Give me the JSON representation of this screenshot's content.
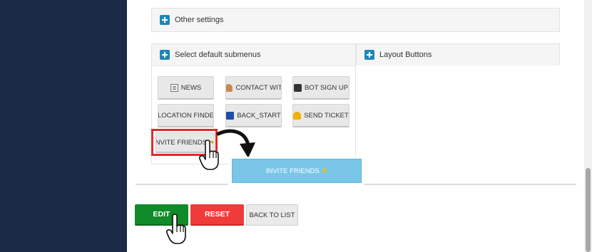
{
  "panels": {
    "other_settings": "Other settings",
    "select_default_submenus": "Select default submenus",
    "layout_buttons": "Layout Buttons"
  },
  "submenu_buttons": [
    {
      "label": "NEWS",
      "icon": "news-icon"
    },
    {
      "label": "CONTACT WIT",
      "icon": "contact-icon"
    },
    {
      "label": "BOT SIGN UP",
      "icon": "bot-icon"
    },
    {
      "label": "LOCATION FINDE",
      "icon": ""
    },
    {
      "label": "BACK_START",
      "icon": "back-icon"
    },
    {
      "label": "SEND TICKET",
      "icon": "bell-icon"
    }
  ],
  "invite_button": {
    "label": "INVITE FRIENDS",
    "icon": "gift-icon"
  },
  "dragging_button": {
    "label": "INVITE FRIENDS",
    "icon": "gift-icon"
  },
  "actions": {
    "edit": "EDIT",
    "reset": "RESET",
    "back": "BACK TO LIST"
  },
  "colors": {
    "sidebar": "#1c2b45",
    "accent_plus": "#1e86b9",
    "edit": "#118a2a",
    "reset": "#f03b3b",
    "highlight_border": "#e22a2a",
    "drag_ghost": "#79c6e9"
  }
}
